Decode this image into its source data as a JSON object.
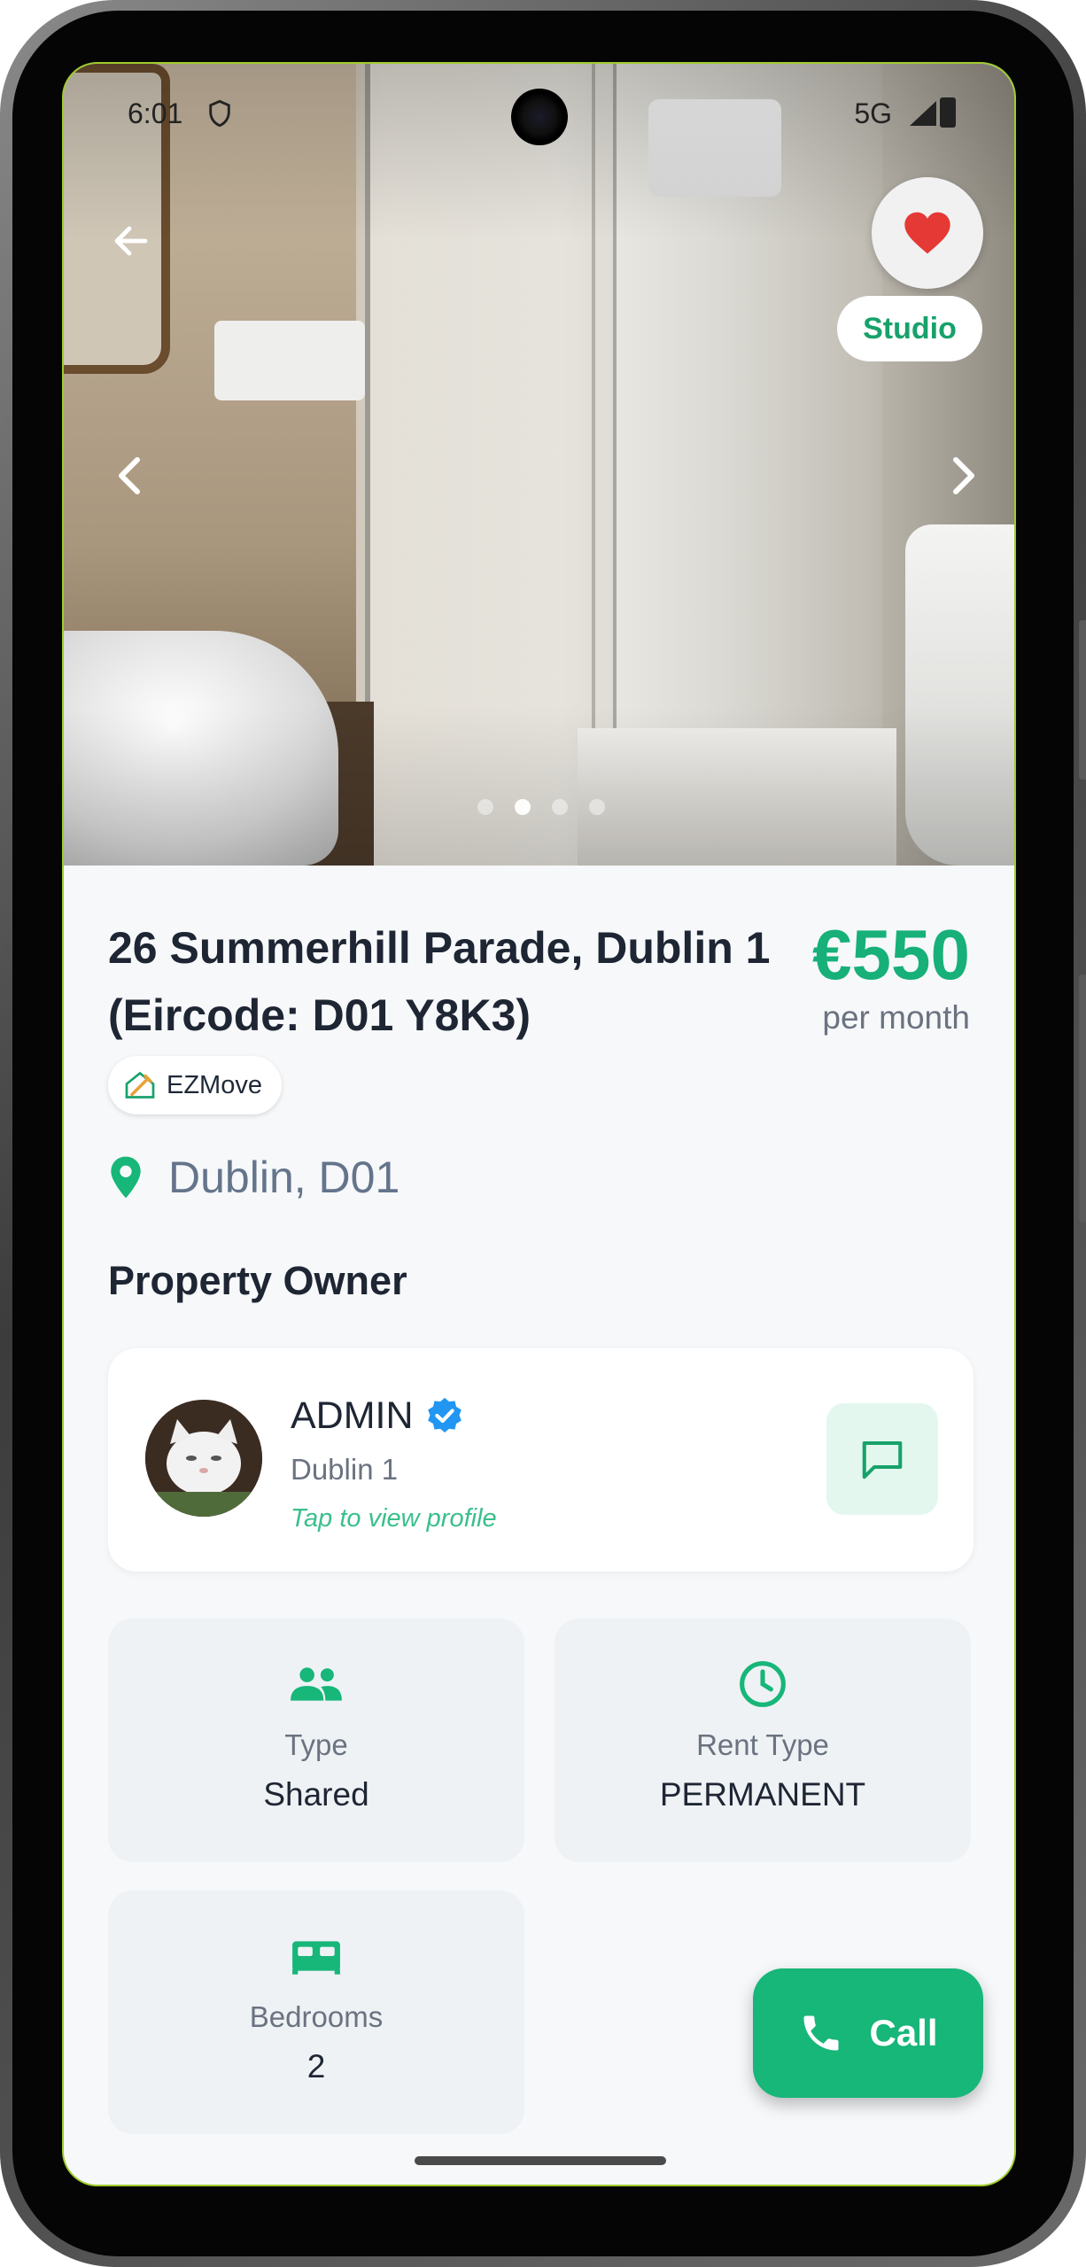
{
  "status_bar": {
    "time": "6:01",
    "network": "5G"
  },
  "listing": {
    "type_badge": "Studio",
    "title": "26 Summerhill Parade, Dublin 1 (Eircode: D01 Y8K3)",
    "price": "€550",
    "price_period": "per month",
    "agency": "EZMove",
    "location": "Dublin, D01",
    "photo_count": 4,
    "active_photo_index": 1,
    "favorited": true
  },
  "owner_section": {
    "title": "Property Owner",
    "name": "ADMIN",
    "location": "Dublin 1",
    "tap_hint": "Tap to view profile",
    "verified": true
  },
  "details": [
    {
      "label": "Type",
      "value": "Shared",
      "icon": "people-icon"
    },
    {
      "label": "Rent Type",
      "value": "PERMANENT",
      "icon": "clock-icon"
    },
    {
      "label": "Bedrooms",
      "value": "2",
      "icon": "bed-icon"
    }
  ],
  "actions": {
    "call_label": "Call"
  },
  "colors": {
    "accent": "#17b679",
    "favorite": "#e53935",
    "verified": "#2196f3"
  }
}
